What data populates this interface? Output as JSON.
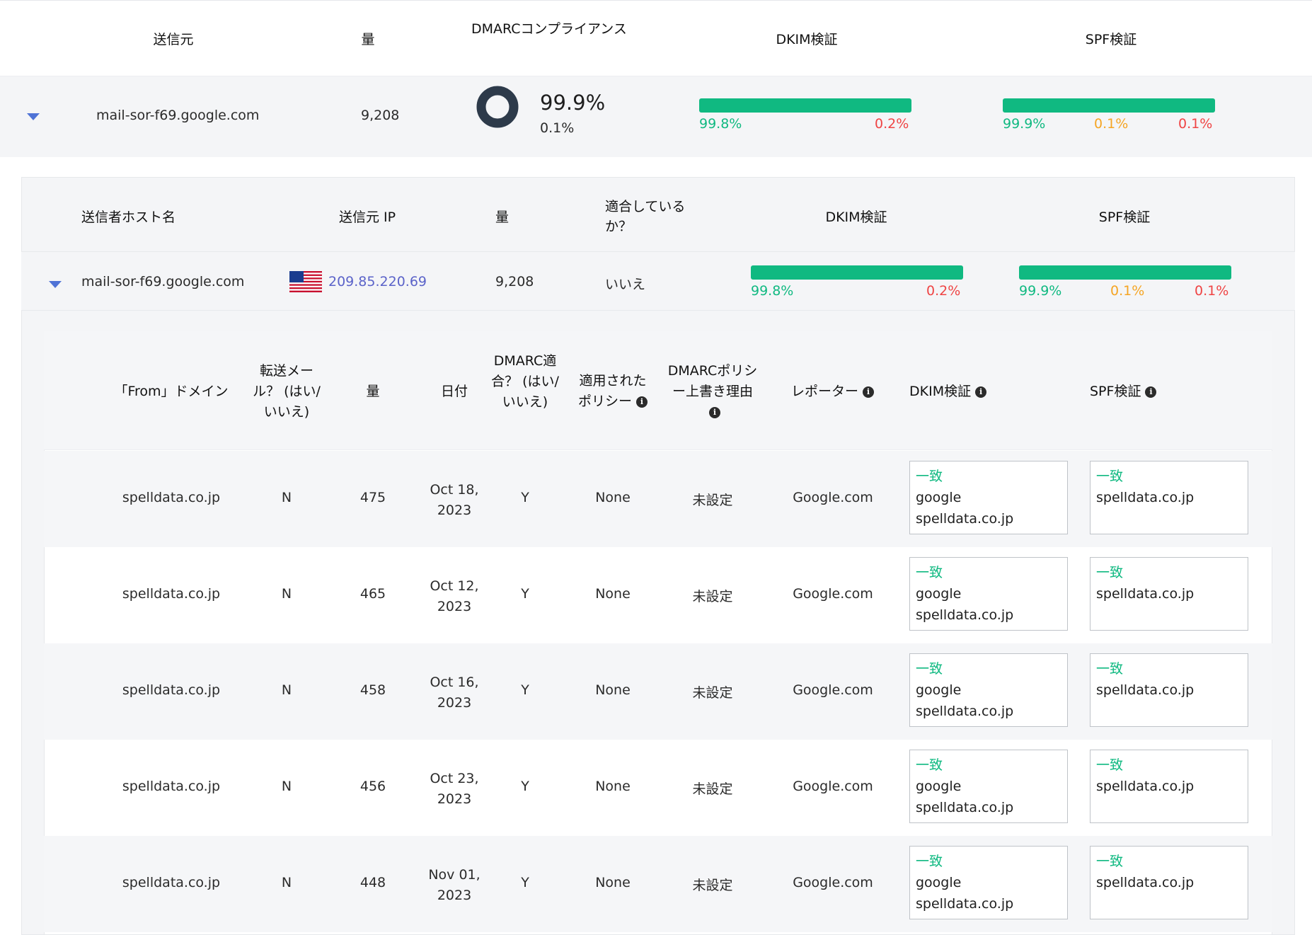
{
  "level1": {
    "headers": {
      "source": "送信元",
      "volume": "量",
      "dmarc_compliance": "DMARCコンプライアンス",
      "dkim": "DKIM検証",
      "spf": "SPF検証"
    },
    "row": {
      "source": "mail-sor-f69.google.com",
      "volume": "9,208",
      "compliance_pass": "99.9%",
      "compliance_fail": "0.1%",
      "compliance_fraction": 0.999,
      "dkim_pass": "99.8%",
      "dkim_fail": "0.2%",
      "spf_pass": "99.9%",
      "spf_warn": "0.1%",
      "spf_fail": "0.1%"
    }
  },
  "level2": {
    "headers": {
      "hostname": "送信者ホスト名",
      "source_ip": "送信元 IP",
      "volume": "量",
      "compliant": "適合している か？",
      "dkim": "DKIM検証",
      "spf": "SPF検証"
    },
    "row": {
      "hostname": "mail-sor-f69.google.com",
      "country_flag": "us-flag",
      "source_ip": "209.85.220.69",
      "volume": "9,208",
      "compliant": "いいえ",
      "dkim_pass": "99.8%",
      "dkim_fail": "0.2%",
      "spf_pass": "99.9%",
      "spf_warn": "0.1%",
      "spf_fail": "0.1%"
    }
  },
  "level3": {
    "headers": {
      "from_domain": "「From」ドメイン",
      "forwarded": "転送メール？ (はい/いいえ)",
      "volume": "量",
      "date": "日付",
      "dmarc_compliant": "DMARC適合？ (はい/いいえ)",
      "applied_policy": "適用されたポリシー",
      "override_reason": "DMARCポリシー上書き理由",
      "reporter": "レポーター",
      "dkim": "DKIM検証",
      "spf": "SPF検証"
    },
    "rows": [
      {
        "from_domain": "spelldata.co.jp",
        "forwarded": "N",
        "volume": "475",
        "date": "Oct 18, 2023",
        "dmarc": "Y",
        "policy": "None",
        "override": "未設定",
        "reporter": "Google.com",
        "dkim_tag": "一致",
        "dkim_domain1": "google",
        "dkim_domain2": "spelldata.co.jp",
        "spf_tag": "一致",
        "spf_domain": "spelldata.co.jp"
      },
      {
        "from_domain": "spelldata.co.jp",
        "forwarded": "N",
        "volume": "465",
        "date": "Oct 12, 2023",
        "dmarc": "Y",
        "policy": "None",
        "override": "未設定",
        "reporter": "Google.com",
        "dkim_tag": "一致",
        "dkim_domain1": "google",
        "dkim_domain2": "spelldata.co.jp",
        "spf_tag": "一致",
        "spf_domain": "spelldata.co.jp"
      },
      {
        "from_domain": "spelldata.co.jp",
        "forwarded": "N",
        "volume": "458",
        "date": "Oct 16, 2023",
        "dmarc": "Y",
        "policy": "None",
        "override": "未設定",
        "reporter": "Google.com",
        "dkim_tag": "一致",
        "dkim_domain1": "google",
        "dkim_domain2": "spelldata.co.jp",
        "spf_tag": "一致",
        "spf_domain": "spelldata.co.jp"
      },
      {
        "from_domain": "spelldata.co.jp",
        "forwarded": "N",
        "volume": "456",
        "date": "Oct 23, 2023",
        "dmarc": "Y",
        "policy": "None",
        "override": "未設定",
        "reporter": "Google.com",
        "dkim_tag": "一致",
        "dkim_domain1": "google",
        "dkim_domain2": "spelldata.co.jp",
        "spf_tag": "一致",
        "spf_domain": "spelldata.co.jp"
      },
      {
        "from_domain": "spelldata.co.jp",
        "forwarded": "N",
        "volume": "448",
        "date": "Nov 01, 2023",
        "dmarc": "Y",
        "policy": "None",
        "override": "未設定",
        "reporter": "Google.com",
        "dkim_tag": "一致",
        "dkim_domain1": "google",
        "dkim_domain2": "spelldata.co.jp",
        "spf_tag": "一致",
        "spf_domain": "spelldata.co.jp"
      }
    ]
  },
  "colors": {
    "pass": "#10b981",
    "warn": "#f5a524",
    "fail": "#ef4444",
    "donut": "#2d3a4a",
    "link": "#5b63c9",
    "caret": "#4f73d6"
  },
  "icons": {
    "expand": "caret-down-icon",
    "info": "info-icon",
    "flag": "us-flag"
  }
}
